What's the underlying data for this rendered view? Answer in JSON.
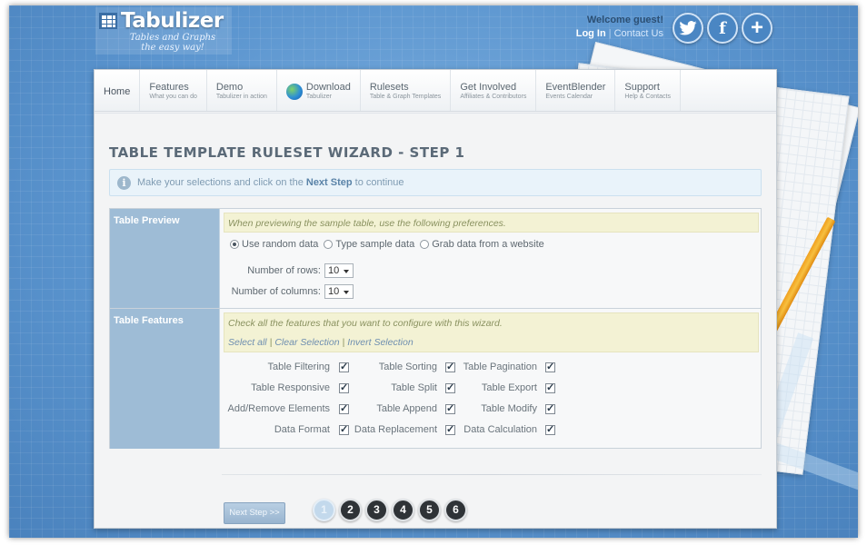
{
  "header": {
    "logo_title": "Tabulizer",
    "logo_tagline_1": "Tables and Graphs",
    "logo_tagline_2": "the easy way!",
    "welcome": "Welcome guest!",
    "login": "Log In",
    "separator": "|",
    "contact": "Contact Us"
  },
  "nav": [
    {
      "label": "Home",
      "sub": ""
    },
    {
      "label": "Features",
      "sub": "What you can do"
    },
    {
      "label": "Demo",
      "sub": "Tabulizer in action"
    },
    {
      "label": "Download",
      "sub": "Tabulizer"
    },
    {
      "label": "Rulesets",
      "sub": "Table & Graph Templates"
    },
    {
      "label": "Get Involved",
      "sub": "Affiliates & Contributors"
    },
    {
      "label": "EventBlender",
      "sub": "Events Calendar"
    },
    {
      "label": "Support",
      "sub": "Help & Contacts"
    }
  ],
  "wizard": {
    "title": "TABLE TEMPLATE RULESET WIZARD - STEP 1",
    "info_pre": "Make your selections and click on the ",
    "info_bold": "Next Step",
    "info_post": " to continue"
  },
  "preview": {
    "section_label": "Table Preview",
    "hint": "When previewing the sample table, use the following preferences.",
    "radio_random": "Use random data",
    "radio_sample": "Type sample data",
    "radio_website": "Grab data from a website",
    "rows_label": "Number of rows:",
    "rows_value": "10",
    "cols_label": "Number of columns:",
    "cols_value": "10"
  },
  "features": {
    "section_label": "Table Features",
    "hint": "Check all the features that you want to configure with this wizard.",
    "select_all": "Select all",
    "bar": "|",
    "clear_selection": "Clear Selection",
    "invert_selection": "Invert Selection",
    "items": [
      "Table Filtering",
      "Table Sorting",
      "Table Pagination",
      "Table Responsive",
      "Table Split",
      "Table Export",
      "Add/Remove Elements",
      "Table Append",
      "Table Modify",
      "Data Format",
      "Data Replacement",
      "Data Calculation"
    ]
  },
  "footer": {
    "next_button": "Next Step >>",
    "steps": [
      "1",
      "2",
      "3",
      "4",
      "5",
      "6"
    ],
    "active_step": 1
  },
  "icons": {
    "twitter": "bird-icon",
    "facebook": "f",
    "plus": "+",
    "info": "i"
  }
}
